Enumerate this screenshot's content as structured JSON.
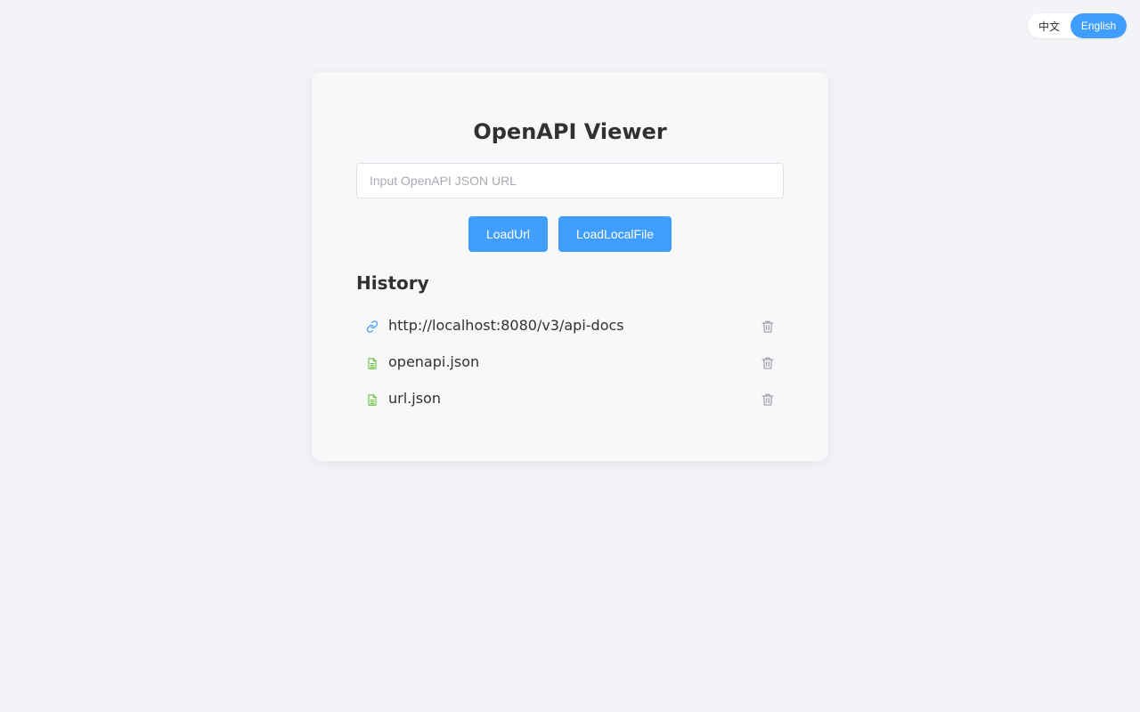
{
  "language_switch": {
    "zh_label": "中文",
    "en_label": "English",
    "active": "English",
    "active_color": "#409eff"
  },
  "main": {
    "title": "OpenAPI Viewer",
    "url_input": {
      "value": "",
      "placeholder": "Input OpenAPI JSON URL"
    },
    "buttons": {
      "load_url_label": "LoadUrl",
      "load_local_file_label": "LoadLocalFile"
    },
    "history": {
      "heading": "History",
      "items": [
        {
          "label": "http://localhost:8080/v3/api-docs",
          "icon": "link-icon",
          "icon_color": "#409eff"
        },
        {
          "label": "openapi.json",
          "icon": "document-icon",
          "icon_color": "#67c23a"
        },
        {
          "label": "url.json",
          "icon": "document-icon",
          "icon_color": "#67c23a"
        }
      ],
      "delete_icon": "trash-icon",
      "delete_icon_color": "#909399"
    }
  }
}
